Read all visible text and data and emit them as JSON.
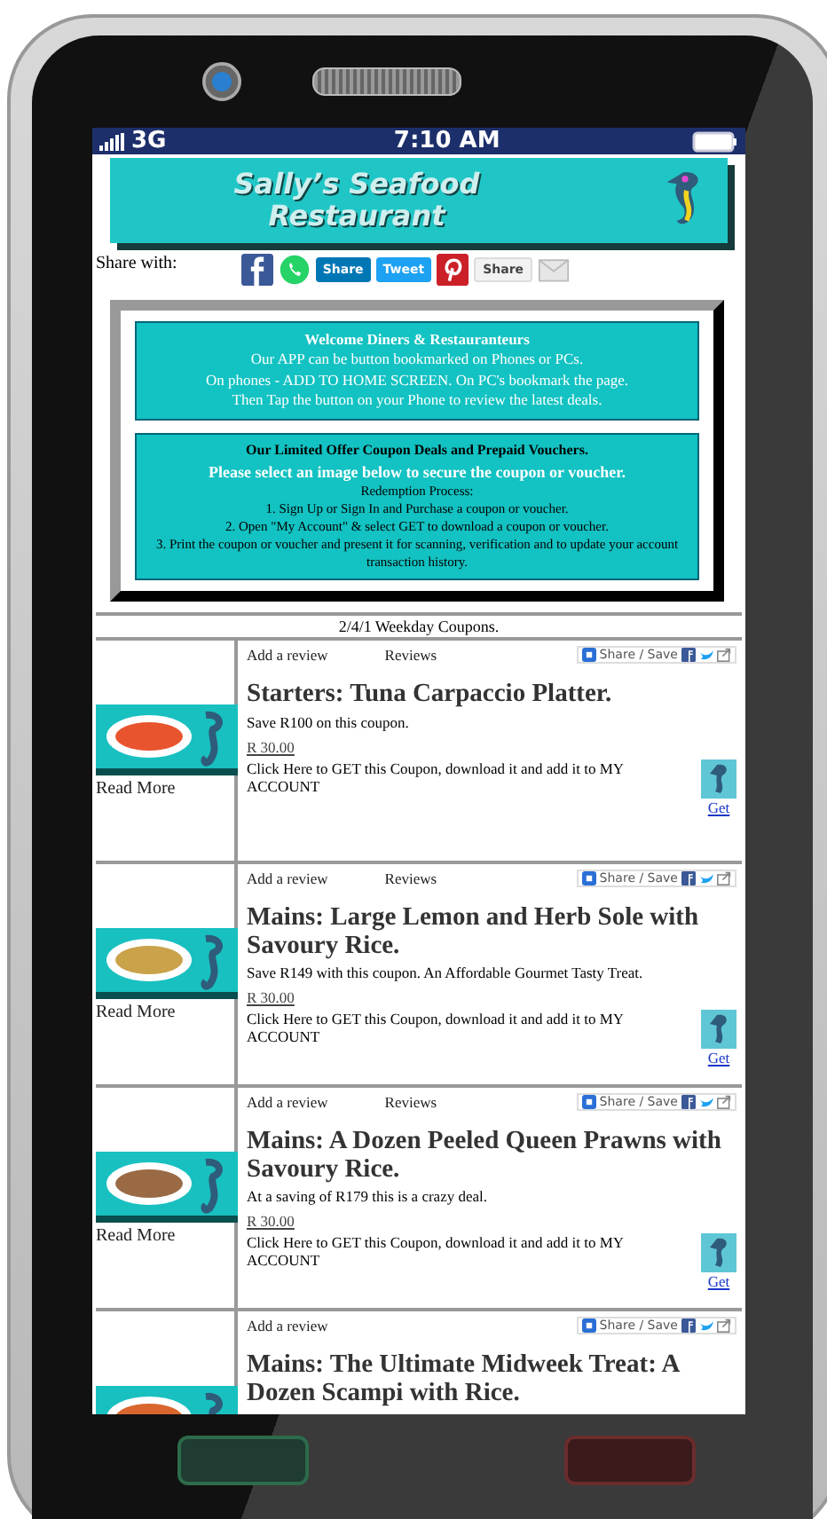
{
  "status_bar": {
    "network": "3G",
    "time": "7:10 AM"
  },
  "banner": {
    "title": "Sally’s Seafood Restaurant"
  },
  "share": {
    "label": "Share with:",
    "buttons": [
      {
        "kind": "facebook"
      },
      {
        "kind": "whatsapp"
      },
      {
        "kind": "linkedin",
        "label": "Share"
      },
      {
        "kind": "twitter",
        "label": "Tweet"
      },
      {
        "kind": "pinterest"
      },
      {
        "kind": "google",
        "label": "Share"
      },
      {
        "kind": "email"
      }
    ]
  },
  "welcome_box": {
    "lines": [
      "Welcome Diners & Restauranteurs",
      "Our APP can be button bookmarked on Phones or PCs.",
      "On phones - ADD TO HOME SCREEN.   On PC's bookmark the page.",
      "Then Tap the button on your Phone to review the latest deals."
    ]
  },
  "offer_box": {
    "heading": "Our Limited Offer Coupon Deals and Prepaid Vouchers.",
    "subheading": "Please select an image below to secure the coupon or voucher.",
    "lines": [
      "Redemption Process:",
      "1. Sign Up or Sign In and Purchase a coupon or voucher.",
      "2. Open \"My Account\" & select GET to download a coupon or voucher.",
      "3. Print the coupon or voucher and present it for scanning, verification and to update your account transaction history."
    ]
  },
  "section_title": "2/4/1 Weekday Coupons.",
  "coupons": [
    {
      "add_review": "Add a review",
      "reviews": "Reviews",
      "share_save": "Share / Save",
      "title": "Starters: Tuna Carpaccio Platter.",
      "description": "Save R100 on this coupon.",
      "price": "R  30.00",
      "get_text": "Click Here to GET this Coupon, download it and add it to MY ACCOUNT",
      "get_link": "Get",
      "read_more": "Read More",
      "color": "#e8542e"
    },
    {
      "add_review": "Add a review",
      "reviews": "Reviews",
      "share_save": "Share / Save",
      "title": "Mains: Large Lemon and Herb Sole with Savoury Rice.",
      "description": "Save R149 with this coupon. An Affordable Gourmet Tasty Treat.",
      "price": "R  30.00",
      "get_text": "Click Here to GET this Coupon, download it and add it to MY ACCOUNT",
      "get_link": "Get",
      "read_more": "Read More",
      "color": "#c9a24a"
    },
    {
      "add_review": "Add a review",
      "reviews": "Reviews",
      "share_save": "Share / Save",
      "title": "Mains: A Dozen Peeled Queen Prawns with Savoury Rice.",
      "description": "At a saving of R179 this is a crazy deal.",
      "price": "R  30.00",
      "get_text": "Click Here to GET this Coupon, download it and add it to MY ACCOUNT",
      "get_link": "Get",
      "read_more": "Read More",
      "color": "#9a6a45"
    },
    {
      "add_review": "Add a review",
      "share_save": "Share / Save",
      "title": "Mains: The Ultimate Midweek Treat: A Dozen Scampi with Rice.",
      "color": "#d9662e"
    }
  ]
}
